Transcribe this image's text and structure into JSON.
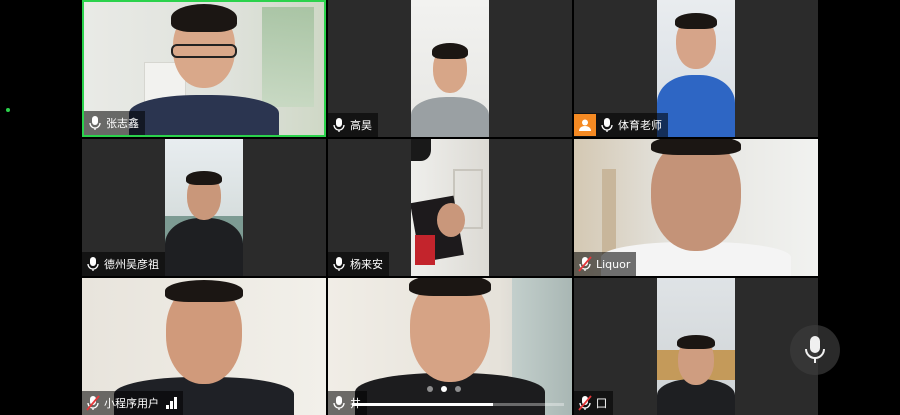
{
  "participants": [
    {
      "name": "张志鑫",
      "muted": false
    },
    {
      "name": "高昊",
      "muted": false
    },
    {
      "name": "体育老师",
      "muted": false,
      "badge": "person-badge"
    },
    {
      "name": "德州吴彦祖",
      "muted": false
    },
    {
      "name": "杨来安",
      "muted": false
    },
    {
      "name": "Liquor",
      "muted": true
    },
    {
      "name": "小程序用户",
      "muted": true
    },
    {
      "name": "井",
      "muted": false
    },
    {
      "name": "囗",
      "muted": true
    }
  ],
  "pager": {
    "pages": 3,
    "current": 2
  },
  "colors": {
    "active_border": "#2bd24c",
    "badge": "#f58a23",
    "tile_bg": "#2b2b2b"
  }
}
